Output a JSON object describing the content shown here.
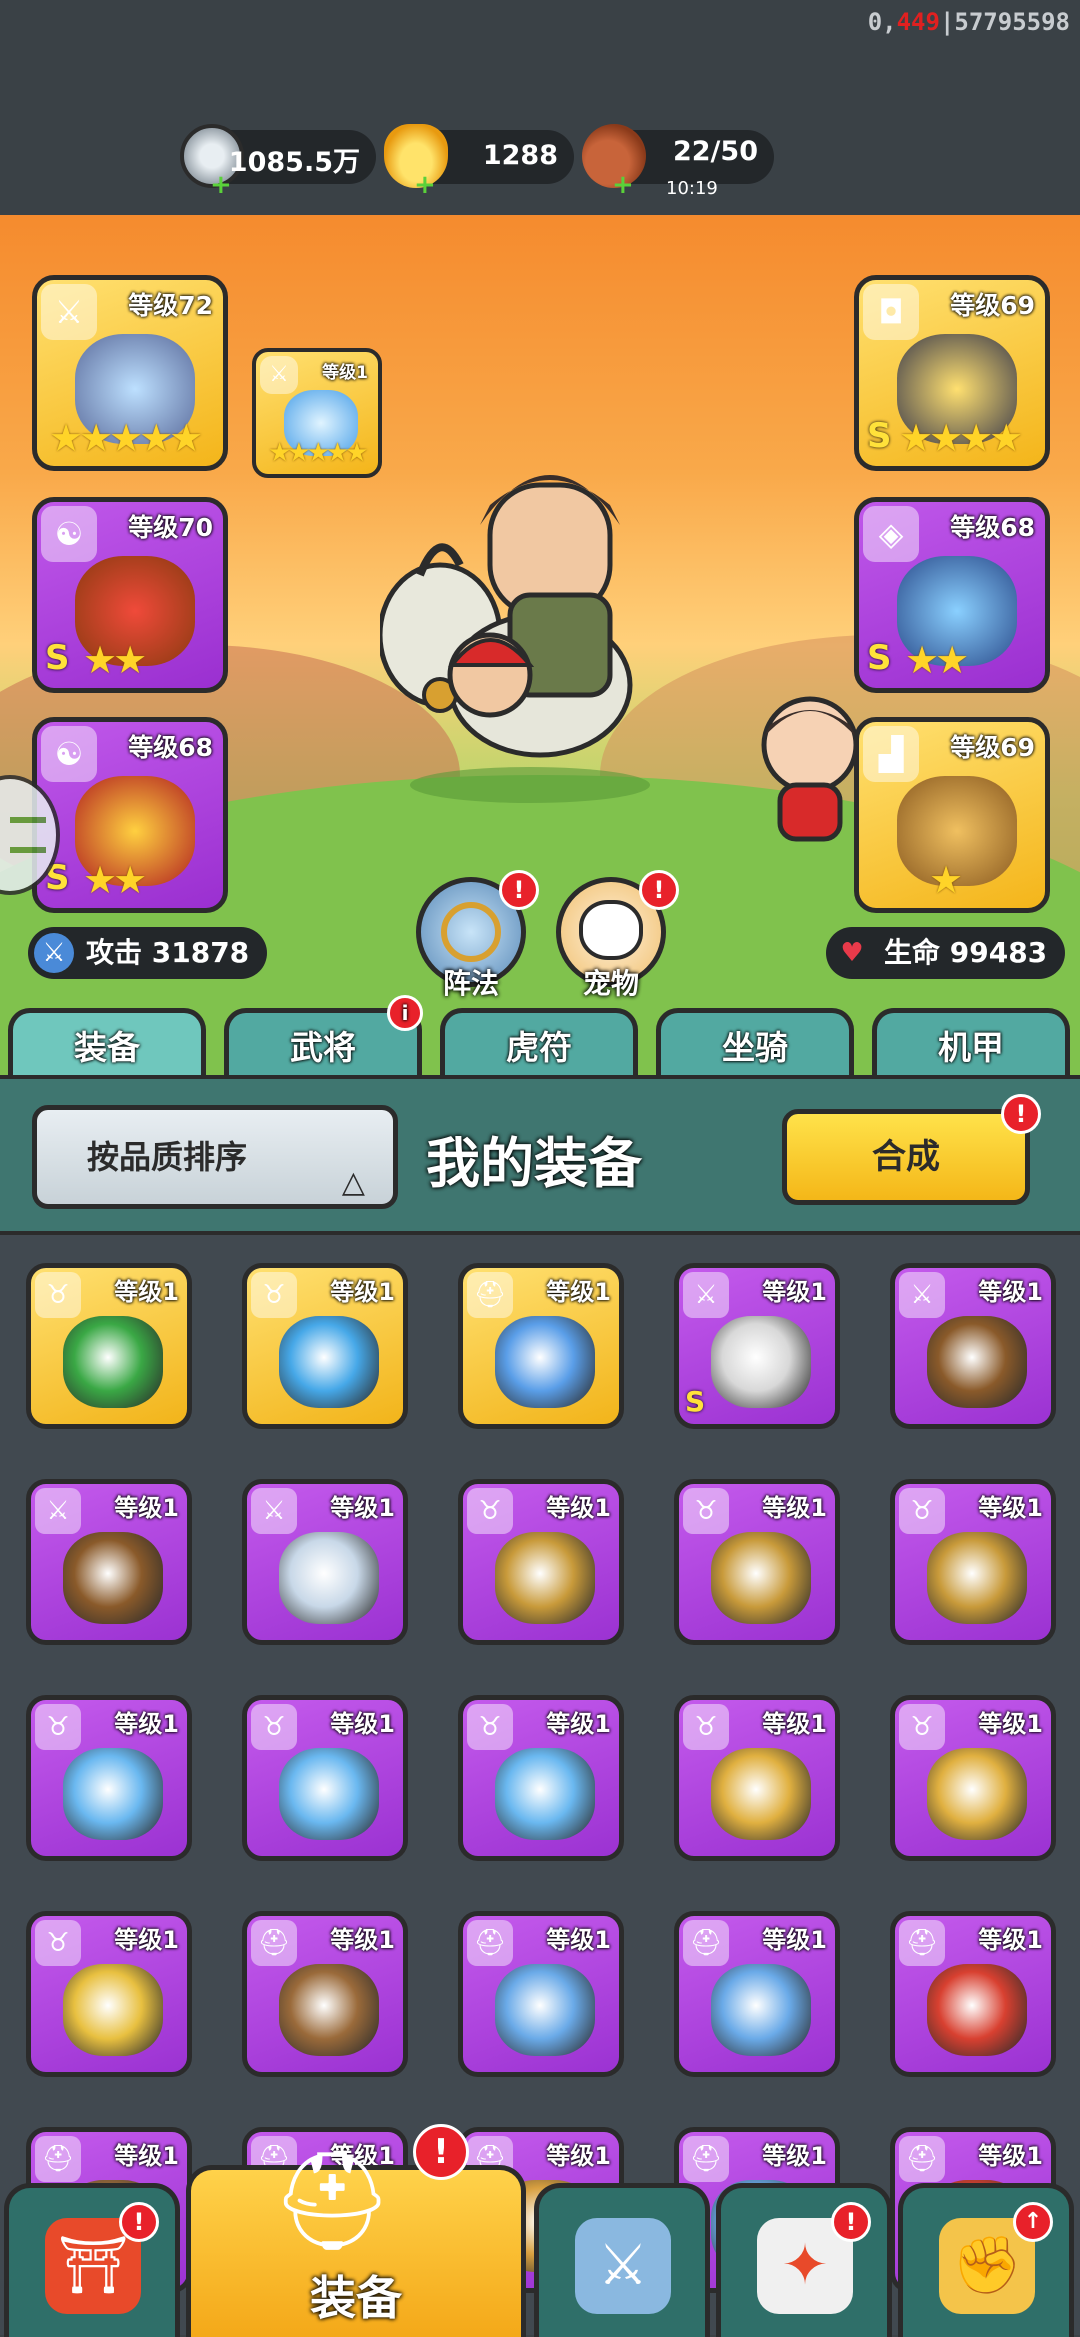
{
  "session_id": {
    "prefix": "0,",
    "highlight": "449",
    "suffix": "|57795598"
  },
  "resources": [
    {
      "icon": "silver-coin-icon",
      "value": "1085.5万"
    },
    {
      "icon": "gold-ingot-icon",
      "value": "1288"
    },
    {
      "icon": "meat-drumstick-icon",
      "value": "22/50",
      "timer": "10:19"
    }
  ],
  "equipped": {
    "weapon": {
      "level": "等级72",
      "stars": "★★★★★",
      "quality": "gold",
      "icon": "sword-icon"
    },
    "weapon_sub": {
      "level": "等级1",
      "stars": "★★★★★",
      "quality": "gold",
      "icon": "sword-icon"
    },
    "armor": {
      "level": "等级69",
      "stars": "★★★★",
      "quality": "gold",
      "icon": "armor-icon",
      "grade": "S"
    },
    "talisman1": {
      "level": "等级70",
      "stars": "★★",
      "quality": "purple",
      "icon": "yin-yang-icon",
      "grade": "S"
    },
    "bracer": {
      "level": "等级68",
      "stars": "★★",
      "quality": "purple",
      "icon": "bracer-icon",
      "grade": "S"
    },
    "talisman2": {
      "level": "等级68",
      "stars": "★★",
      "quality": "purple",
      "icon": "yin-yang-icon",
      "grade": "S"
    },
    "boots": {
      "level": "等级69",
      "stars": "★",
      "quality": "gold",
      "icon": "boot-icon"
    }
  },
  "stats": {
    "attack": "攻击 31878",
    "hp": "生命 99483"
  },
  "round_buttons": {
    "formation": "阵法",
    "pet": "宠物"
  },
  "badge_text": "!",
  "info_badge": "i",
  "tabs": [
    "装备",
    "武将",
    "虎符",
    "坐骑",
    "机甲"
  ],
  "panel": {
    "sort_label": "按品质排序",
    "sort_arrow": "△",
    "title": "我的装备",
    "merge_label": "合成"
  },
  "items": [
    {
      "q": "gold",
      "tag": "♉",
      "lv": "等级1",
      "art": "#3aa845"
    },
    {
      "q": "gold",
      "tag": "♉",
      "lv": "等级1",
      "art": "#46a8e8"
    },
    {
      "q": "gold",
      "tag": "⛑",
      "lv": "等级1",
      "art": "#5a9ee8"
    },
    {
      "q": "purple",
      "tag": "⚔",
      "lv": "等级1",
      "art": "#d8d8d8",
      "s": "S"
    },
    {
      "q": "purple",
      "tag": "⚔",
      "lv": "等级1",
      "art": "#8a5a2a"
    },
    {
      "q": "purple",
      "tag": "⚔",
      "lv": "等级1",
      "art": "#8a5a2a"
    },
    {
      "q": "purple",
      "tag": "⚔",
      "lv": "等级1",
      "art": "#c8d8e8"
    },
    {
      "q": "purple",
      "tag": "♉",
      "lv": "等级1",
      "art": "#c89a3a"
    },
    {
      "q": "purple",
      "tag": "♉",
      "lv": "等级1",
      "art": "#c89a3a"
    },
    {
      "q": "purple",
      "tag": "♉",
      "lv": "等级1",
      "art": "#c89a3a"
    },
    {
      "q": "purple",
      "tag": "♉",
      "lv": "等级1",
      "art": "#6ab8f0"
    },
    {
      "q": "purple",
      "tag": "♉",
      "lv": "等级1",
      "art": "#6ab8f0"
    },
    {
      "q": "purple",
      "tag": "♉",
      "lv": "等级1",
      "art": "#6ab8f0"
    },
    {
      "q": "purple",
      "tag": "♉",
      "lv": "等级1",
      "art": "#e0b040"
    },
    {
      "q": "purple",
      "tag": "♉",
      "lv": "等级1",
      "art": "#e0b040"
    },
    {
      "q": "purple",
      "tag": "♉",
      "lv": "等级1",
      "art": "#e8c040"
    },
    {
      "q": "purple",
      "tag": "⛑",
      "lv": "等级1",
      "art": "#9a6a3a"
    },
    {
      "q": "purple",
      "tag": "⛑",
      "lv": "等级1",
      "art": "#6aaae8"
    },
    {
      "q": "purple",
      "tag": "⛑",
      "lv": "等级1",
      "art": "#6aaae8"
    },
    {
      "q": "purple",
      "tag": "⛑",
      "lv": "等级1",
      "art": "#d84030"
    },
    {
      "q": "purple",
      "tag": "⛑",
      "lv": "等级1",
      "art": "#9a6a3a"
    },
    {
      "q": "purple",
      "tag": "⛑",
      "lv": "等级1",
      "art": "#9a6a3a"
    },
    {
      "q": "purple",
      "tag": "⛑",
      "lv": "等级1",
      "art": "#d8a040"
    },
    {
      "q": "purple",
      "tag": "⛑",
      "lv": "等级1",
      "art": "#6aaae8"
    },
    {
      "q": "purple",
      "tag": "⛑",
      "lv": "等级1",
      "art": "#d84030"
    }
  ],
  "bottom_nav": {
    "equip_label": "装备"
  },
  "colors": {
    "gold": "#f4b51a",
    "purple": "#9a2fd0",
    "badge": "#e8212a",
    "tab": "#52a9a1"
  }
}
